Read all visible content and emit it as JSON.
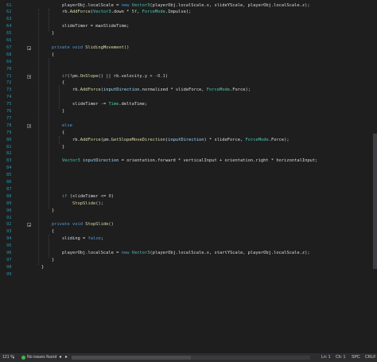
{
  "editor": {
    "lines": [
      {
        "num": "61",
        "indent": 2,
        "tokens": [
          [
            "pl",
            "playerObj.localScale = "
          ],
          [
            "kw",
            "new "
          ],
          [
            "ty",
            "Vector3"
          ],
          [
            "pl",
            "(playerObj.localScale.x, slideYScale, playerObj.localScale.z);"
          ]
        ]
      },
      {
        "num": "62",
        "indent": 2,
        "tokens": [
          [
            "pl",
            "rb."
          ],
          [
            "me",
            "AddForce"
          ],
          [
            "pl",
            "("
          ],
          [
            "ty",
            "Vector3"
          ],
          [
            "pl",
            ".down * "
          ],
          [
            "nu",
            "5f"
          ],
          [
            "pl",
            ", "
          ],
          [
            "ty",
            "ForceMode"
          ],
          [
            "pl",
            ".Impulse);"
          ]
        ]
      },
      {
        "num": "63",
        "indent": 0,
        "tokens": []
      },
      {
        "num": "64",
        "indent": 2,
        "tokens": [
          [
            "pl",
            "slideTimer = maxSlideTime;"
          ]
        ]
      },
      {
        "num": "65",
        "indent": 1,
        "tokens": [
          [
            "pl",
            "}"
          ]
        ]
      },
      {
        "num": "66",
        "indent": 0,
        "tokens": []
      },
      {
        "num": "67",
        "indent": 1,
        "fold": true,
        "tokens": [
          [
            "kw",
            "private void "
          ],
          [
            "me",
            "SlidingMovement"
          ],
          [
            "pl",
            "()"
          ]
        ]
      },
      {
        "num": "68",
        "indent": 1,
        "tokens": [
          [
            "pl",
            "{"
          ]
        ]
      },
      {
        "num": "69",
        "indent": 0,
        "tokens": []
      },
      {
        "num": "70",
        "indent": 0,
        "tokens": []
      },
      {
        "num": "71",
        "indent": 2,
        "fold": true,
        "tokens": [
          [
            "kw",
            "if"
          ],
          [
            "pl",
            "(!pm."
          ],
          [
            "me",
            "OnSlope"
          ],
          [
            "pl",
            "() || rb.velocity.y > "
          ],
          [
            "nu",
            "-0.1"
          ],
          [
            "pl",
            ")"
          ]
        ]
      },
      {
        "num": "72",
        "indent": 2,
        "tokens": [
          [
            "pl",
            "{"
          ]
        ]
      },
      {
        "num": "73",
        "indent": 3,
        "tokens": [
          [
            "pl",
            "rb."
          ],
          [
            "me",
            "AddForce"
          ],
          [
            "pl",
            "("
          ],
          [
            "pa",
            "inputDirection"
          ],
          [
            "pl",
            ".normalized * slideForce, "
          ],
          [
            "ty",
            "ForceMode"
          ],
          [
            "pl",
            ".Force);"
          ]
        ]
      },
      {
        "num": "74",
        "indent": 0,
        "tokens": []
      },
      {
        "num": "75",
        "indent": 3,
        "tokens": [
          [
            "pl",
            "slideTimer -= "
          ],
          [
            "ty",
            "Time"
          ],
          [
            "pl",
            ".deltaTime;"
          ]
        ]
      },
      {
        "num": "76",
        "indent": 2,
        "tokens": [
          [
            "pl",
            "}"
          ]
        ]
      },
      {
        "num": "77",
        "indent": 0,
        "tokens": []
      },
      {
        "num": "78",
        "indent": 2,
        "fold": true,
        "tokens": [
          [
            "kw",
            "else"
          ]
        ]
      },
      {
        "num": "79",
        "indent": 2,
        "tokens": [
          [
            "pl",
            "{"
          ]
        ]
      },
      {
        "num": "80",
        "indent": 3,
        "tokens": [
          [
            "pl",
            "rb."
          ],
          [
            "me",
            "AddForce"
          ],
          [
            "pl",
            "(pm."
          ],
          [
            "me",
            "GetSlopeMoveDirection"
          ],
          [
            "pl",
            "("
          ],
          [
            "pa",
            "inputDirection"
          ],
          [
            "pl",
            ") * slideForce, "
          ],
          [
            "ty",
            "ForceMode"
          ],
          [
            "pl",
            ".Force);"
          ]
        ]
      },
      {
        "num": "81",
        "indent": 2,
        "tokens": [
          [
            "pl",
            "}"
          ]
        ]
      },
      {
        "num": "82",
        "indent": 0,
        "tokens": []
      },
      {
        "num": "83",
        "indent": 2,
        "tokens": [
          [
            "ty",
            "Vector3 "
          ],
          [
            "pa",
            "inputDirection"
          ],
          [
            "pl",
            " = orientation.forward * verticalInput + orientation.right * horizontalInput;"
          ]
        ]
      },
      {
        "num": "84",
        "indent": 0,
        "tokens": []
      },
      {
        "num": "85",
        "indent": 0,
        "tokens": []
      },
      {
        "num": "86",
        "indent": 0,
        "tokens": []
      },
      {
        "num": "87",
        "indent": 0,
        "tokens": []
      },
      {
        "num": "88",
        "indent": 2,
        "tokens": [
          [
            "kw",
            "if "
          ],
          [
            "pl",
            "(slideTimer <= "
          ],
          [
            "nu",
            "0"
          ],
          [
            "pl",
            ")"
          ]
        ]
      },
      {
        "num": "89",
        "indent": 3,
        "tokens": [
          [
            "me",
            "StopSlide"
          ],
          [
            "pl",
            "();"
          ]
        ]
      },
      {
        "num": "90",
        "indent": 1,
        "tokens": [
          [
            "pl",
            "}"
          ]
        ]
      },
      {
        "num": "91",
        "indent": 0,
        "tokens": []
      },
      {
        "num": "92",
        "indent": 1,
        "fold": true,
        "tokens": [
          [
            "kw",
            "private void "
          ],
          [
            "me",
            "StopSlide"
          ],
          [
            "pl",
            "()"
          ]
        ]
      },
      {
        "num": "93",
        "indent": 1,
        "tokens": [
          [
            "pl",
            "{"
          ]
        ]
      },
      {
        "num": "94",
        "indent": 2,
        "tokens": [
          [
            "pl",
            "sliding = "
          ],
          [
            "kw",
            "false"
          ],
          [
            "pl",
            ";"
          ]
        ]
      },
      {
        "num": "95",
        "indent": 0,
        "tokens": []
      },
      {
        "num": "96",
        "indent": 2,
        "tokens": [
          [
            "pl",
            "playerObj.localScale = "
          ],
          [
            "kw",
            "new "
          ],
          [
            "ty",
            "Vector3"
          ],
          [
            "pl",
            "(playerObj.localScale.x, startYScale, playerObj.localScale.z);"
          ]
        ]
      },
      {
        "num": "97",
        "indent": 1,
        "tokens": [
          [
            "pl",
            "}"
          ]
        ]
      },
      {
        "num": "98",
        "indent": 0,
        "tokens": [
          [
            "pl",
            "}"
          ]
        ]
      },
      {
        "num": "99",
        "indent": 0,
        "tokens": []
      }
    ]
  },
  "statusbar": {
    "zoom": "121 %",
    "zoom_caret": "▾",
    "issues_icon": "check-circle-icon",
    "issues_label": "No issues found",
    "nav_left": "◂",
    "nav_right": "▸",
    "line": "Ln: 1",
    "col": "Ch: 1",
    "spacing": "SPC",
    "eol": "CRLF"
  },
  "colors": {
    "keyword": "#569cd6",
    "type": "#4ec9b0",
    "method": "#dcdcaa",
    "parameter": "#9cdcfe",
    "number": "#b5cea8",
    "line_number": "#2b91af",
    "text": "#dcdcdc",
    "background": "#1e1e1e",
    "status_ok": "#3fb950"
  }
}
